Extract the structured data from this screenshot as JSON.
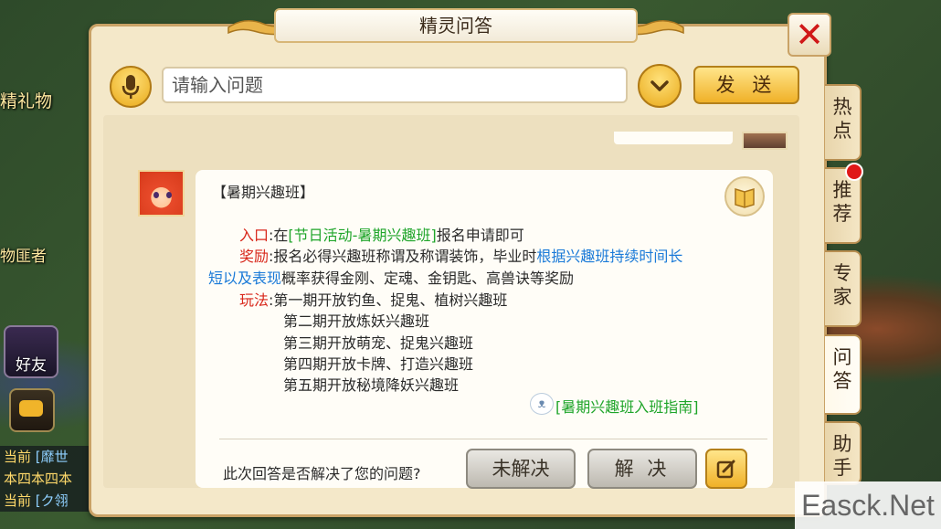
{
  "dialog": {
    "title": "精灵问答",
    "close_label": "✕"
  },
  "input_bar": {
    "placeholder": "请输入问题",
    "send_label": "发 送"
  },
  "answer": {
    "title": "【暑期兴趣班】",
    "entry_label": "入口",
    "entry_prefix": ":在",
    "entry_link": "[节日活动-暑期兴趣班]",
    "entry_suffix": "报名申请即可",
    "reward_label": "奖励",
    "reward_text": ":报名必得兴趣班称谓及称谓装饰，毕业时",
    "reward_highlight_1": "根据兴趣班持续时间长",
    "reward_highlight_2": "短以及表现",
    "reward_text_2": "概率获得金刚、定魂、金钥匙、高兽诀等奖励",
    "play_label": "玩法",
    "play_lines": [
      ":第一期开放钓鱼、捉鬼、植树兴趣班",
      "第二期开放炼妖兴趣班",
      "第三期开放萌宠、捉鬼兴趣班",
      "第四期开放卡牌、打造兴趣班",
      "第五期开放秘境降妖兴趣班"
    ],
    "guide_link": "[暑期兴趣班入班指南]",
    "feedback_question": "此次回答是否解决了您的问题?",
    "unresolved_label": "未解决",
    "resolved_label": "解 决"
  },
  "side_tabs": [
    {
      "label": "热点",
      "active": false
    },
    {
      "label": "推荐",
      "active": false,
      "badge": true
    },
    {
      "label": "专家",
      "active": false
    },
    {
      "label": "问答",
      "active": true
    },
    {
      "label": "助手",
      "active": false
    }
  ],
  "background": {
    "gift_text": "精礼物",
    "guard_text": "物匪者",
    "friends_label": "好友",
    "chat_lines": [
      {
        "channel": "当前",
        "text": "[靡世"
      },
      {
        "channel": "",
        "text": "本四本四本"
      },
      {
        "channel": "当前",
        "text": "[ク翎"
      }
    ]
  },
  "watermark": "Easck.Net"
}
